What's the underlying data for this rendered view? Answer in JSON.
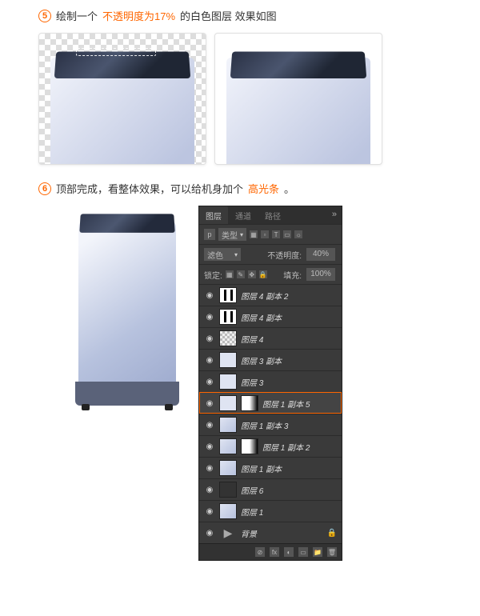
{
  "step5": {
    "num": "5",
    "t1": "绘制一个",
    "hl": "不透明度为17%",
    "t2": "的白色图层  效果如图"
  },
  "step6": {
    "num": "6",
    "t1": "顶部完成，看整体效果，可以给机身加个",
    "hl": "高光条",
    "t2": "。"
  },
  "panel": {
    "tabs": [
      "图层",
      "通道",
      "路径"
    ],
    "close": "»",
    "toolbar_icons": [
      "▦",
      "▫",
      "◯",
      "T",
      "▭",
      "☼"
    ],
    "kind_label": "类型",
    "blend_mode": "滤色",
    "opacity_label": "不透明度:",
    "opacity_value": "40%",
    "lock_label": "锁定:",
    "lock_icons": [
      "▦",
      "✎",
      "✥",
      "🔒"
    ],
    "fill_label": "填充:",
    "fill_value": "100%",
    "layers": [
      {
        "name": "图层 4 副本 2",
        "thumb": "bars",
        "mask": false
      },
      {
        "name": "图层 4 副本",
        "thumb": "bars",
        "mask": false
      },
      {
        "name": "图层 4",
        "thumb": "chk",
        "mask": false
      },
      {
        "name": "图层 3 副本",
        "thumb": "pale",
        "mask": false
      },
      {
        "name": "图层 3",
        "thumb": "pale",
        "mask": false
      },
      {
        "name": "图层 1 副本 5",
        "thumb": "pale",
        "mask": true,
        "selected": true
      },
      {
        "name": "图层 1 副本 3",
        "thumb": "wm",
        "mask": false
      },
      {
        "name": "图层 1 副本 2",
        "thumb": "wm",
        "mask": true
      },
      {
        "name": "图层 1 副本",
        "thumb": "wm",
        "mask": false
      },
      {
        "name": "图层 6",
        "thumb": "dark",
        "mask": false
      },
      {
        "name": "图层 1",
        "thumb": "wm",
        "mask": false
      },
      {
        "name": "背景",
        "thumb": "folder",
        "mask": false,
        "bg": true
      }
    ],
    "footer_icons": [
      "⊘",
      "fx",
      "◐",
      "▭",
      "📁",
      "🗑"
    ]
  }
}
